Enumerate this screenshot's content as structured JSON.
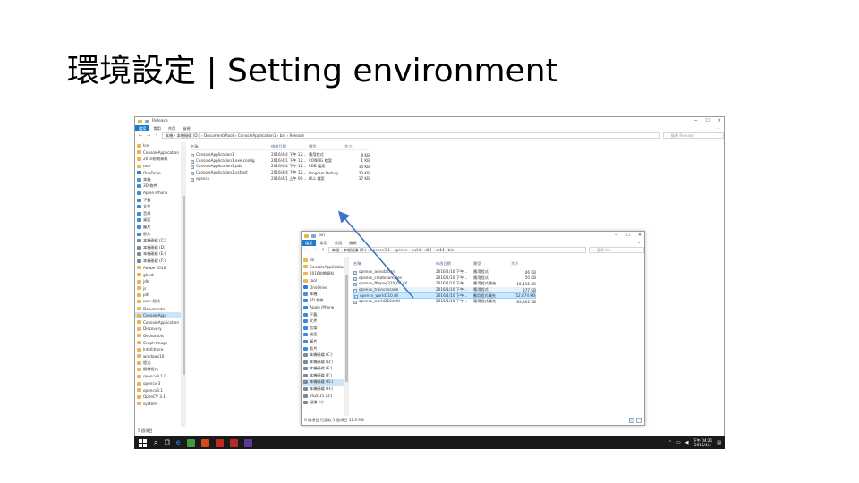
{
  "slide": {
    "title": "環境設定 | Setting environment"
  },
  "win1": {
    "title": "Release",
    "ribbon": [
      "檔案",
      "常用",
      "共用",
      "檢視"
    ],
    "address": [
      "本機",
      "本機磁碟 (D:)",
      "DocumentsRoot",
      "ConsoleApplication1",
      "bin",
      "Release"
    ],
    "search_placeholder": "搜尋 Release",
    "columns": [
      "名稱",
      "修改日期",
      "類型",
      "大小"
    ],
    "files": [
      [
        "ConsoleApplication1",
        "2016/4/4 下午 12:..",
        "應用程式",
        "8 KB"
      ],
      [
        "ConsoleApplication1.exe.config",
        "2016/4/1 下午 12:..",
        "CONFIG 檔案",
        "1 KB"
      ],
      [
        "ConsoleApplication1.pdb",
        "2016/4/4 下午 12:..",
        "PDB 檔案",
        "14 KB"
      ],
      [
        "ConsoleApplication1.vshost",
        "2016/4/4 下午 12:..",
        "Program Debug..",
        "23 KB"
      ],
      [
        "opencv",
        "2016/4/1 上午 09:..",
        "DLL 檔案",
        "17 KB"
      ]
    ],
    "nav": [
      "Ice",
      "ConsoleApplication",
      "2016前期資料",
      "tool",
      "OneDrive",
      "本機",
      "3D 物件",
      "Apple iPhone",
      "下載",
      "文件",
      "音樂",
      "桌面",
      "圖片",
      "影片",
      "本機磁碟 (C:)",
      "本機磁碟 (D:)",
      "本機磁碟 (E:)",
      "本機磁碟 (F:)",
      "Adobe 2016",
      "ghost",
      "jdk",
      "js",
      "pdf",
      "user 程式",
      "Documents",
      "ConsoleApp",
      "ConsoleApplication",
      "Discovery",
      "Geckotools",
      "Graph Image",
      "Intellitrace",
      "windows10",
      "程式",
      "開發程式",
      "opencv3.1.0",
      "opencv-3",
      "opencv3.1",
      "OpenCV 3.1",
      "system"
    ],
    "status": "5 個項目"
  },
  "win2": {
    "title": "bin",
    "ribbon": [
      "檔案",
      "常用",
      "共用",
      "檢視"
    ],
    "address": [
      "本機",
      "本機磁碟 (D:)",
      "opencv3.1",
      "opencv",
      "build",
      "x64",
      "vc14",
      "bin"
    ],
    "search_placeholder": "搜尋 bin",
    "columns": [
      "名稱",
      "修改日期",
      "類型",
      "大小"
    ],
    "files": [
      [
        "opencv_annotation",
        "2016/1/10 下午 ..",
        "應用程式",
        "46 KB"
      ],
      [
        "opencv_createsamples",
        "2016/1/10 下午 ..",
        "應用程式",
        "50 KB"
      ],
      [
        "opencv_ffmpeg310_64.dll",
        "2016/1/10 下午 ..",
        "應用程式擴充",
        "15,416 KB"
      ],
      [
        "opencv_traincascade",
        "2016/1/10 下午 ..",
        "應用程式",
        "377 KB"
      ],
      [
        "opencv_world310.dll",
        "2016/1/10 下午 ..",
        "應用程式擴充",
        "52,874 KB"
      ],
      [
        "opencv_world310d.dll",
        "2016/1/10 下午 ..",
        "應用程式擴充",
        "85,302 KB"
      ]
    ],
    "nav": [
      "lib",
      "ConsoleApplication",
      "2016前期資料",
      "tool",
      "OneDrive",
      "本機",
      "3D 物件",
      "Apple iPhone",
      "下載",
      "文件",
      "音樂",
      "桌面",
      "圖片",
      "影片",
      "本機磁碟 (C:)",
      "本機磁碟 (D:)",
      "本機磁碟 (E:)",
      "本機磁碟 (F:)",
      "本機磁碟 (G:)",
      "本機磁碟 (H:)",
      "VS2015 (D:)",
      "磁碟 (I:)"
    ],
    "status": "6 個項目   已選取 1 個項目 51.6 MB"
  },
  "taskbar": {
    "time": "下午 04:21",
    "date": "2016/4/4",
    "app_icon_colors": [
      "#3d9c40",
      "#d04a1a",
      "#c42b1c",
      "#b32d2e",
      "#5e3a97"
    ]
  }
}
